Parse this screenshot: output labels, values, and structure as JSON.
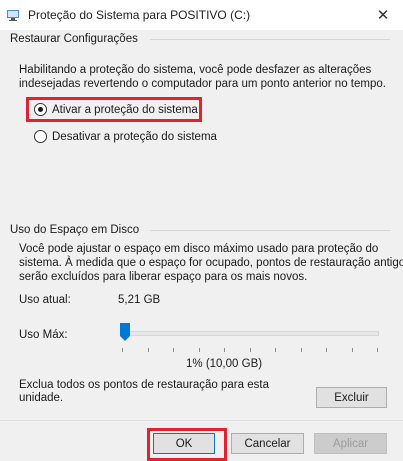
{
  "window": {
    "title": "Proteção do Sistema para POSITIVO (C:)",
    "close_glyph": "✕"
  },
  "restore_settings": {
    "group_label": "Restaurar Configurações",
    "description_line1": "Habilitando a proteção do sistema, você pode desfazer as alterações",
    "description_line2": "indesejadas revertendo o computador para um ponto anterior no tempo.",
    "options": [
      {
        "label": "Ativar a proteção do sistema",
        "selected": true
      },
      {
        "label": "Desativar a proteção do sistema",
        "selected": false
      }
    ]
  },
  "disk_usage": {
    "group_label": "Uso do Espaço em Disco",
    "description_line1": "Você pode ajustar o espaço em disco máximo usado para proteção do",
    "description_line2": "sistema. À medida que o espaço for ocupado, pontos de restauração antigos",
    "description_line3": "serão excluídos para liberar espaço para os mais novos.",
    "current_label": "Uso atual:",
    "current_value": "5,21 GB",
    "max_label": "Uso Máx:",
    "slider_percent": 1,
    "slider_value_text": "1% (10,00 GB)",
    "delete_text_line1": "Exclua todos os pontos de restauração para esta",
    "delete_text_line2": "unidade.",
    "delete_button": "Excluir"
  },
  "footer": {
    "ok": "OK",
    "cancel": "Cancelar",
    "apply": "Aplicar"
  },
  "colors": {
    "highlight": "#e0242f",
    "accent": "#0078d7"
  }
}
